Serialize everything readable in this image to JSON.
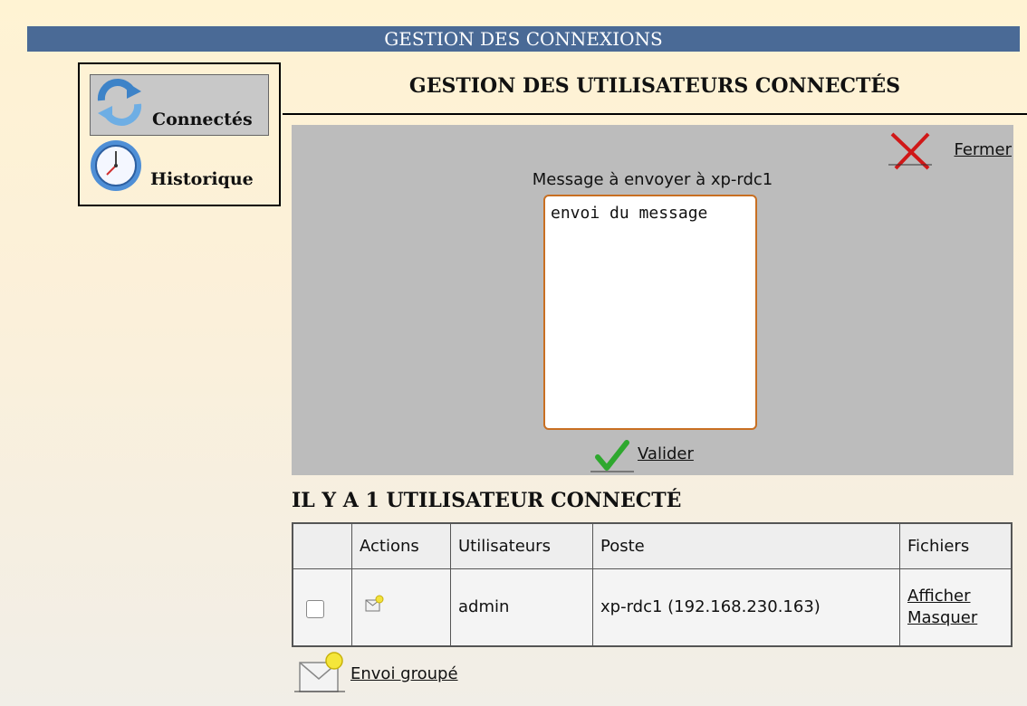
{
  "header": {
    "title": "GESTION DES CONNEXIONS"
  },
  "menu": {
    "items": [
      {
        "label": "Connectés",
        "icon": "refresh-icon",
        "active": true
      },
      {
        "label": "Historique",
        "icon": "clock-icon",
        "active": false
      }
    ]
  },
  "section": {
    "title": "GESTION DES UTILISATEURS CONNECTÉS"
  },
  "message_panel": {
    "close_label": "Fermer",
    "prompt": "Message à envoyer à xp-rdc1",
    "message_value": "envoi du message",
    "validate_label": "Valider"
  },
  "users": {
    "count_title": "IL Y A 1 UTILISATEUR CONNECTÉ",
    "columns": [
      "",
      "Actions",
      "Utilisateurs",
      "Poste",
      "Fichiers"
    ],
    "rows": [
      {
        "checked": false,
        "action_icon": "send-message-icon",
        "user": "admin",
        "poste": "xp-rdc1 (192.168.230.163)",
        "files": [
          "Afficher",
          "Masquer"
        ]
      }
    ]
  },
  "group_send": {
    "label": "Envoi groupé",
    "icon": "group-mail-icon"
  },
  "colors": {
    "header_bar": "#4a6a96",
    "panel_bg": "#bcbcbc",
    "textarea_border": "#c86f22",
    "page_bg_top": "#fff3d3"
  }
}
